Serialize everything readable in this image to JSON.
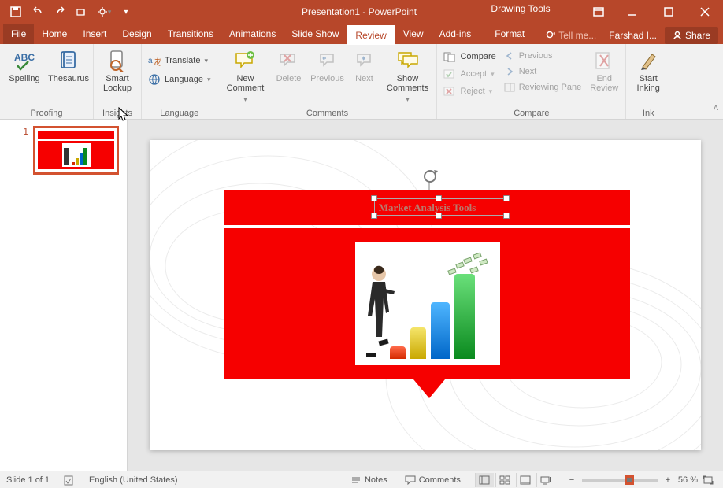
{
  "title": "Presentation1 - PowerPoint",
  "toolContext": {
    "header": "Drawing Tools",
    "tab": "Format"
  },
  "tabs": {
    "file": "File",
    "home": "Home",
    "insert": "Insert",
    "design": "Design",
    "transitions": "Transitions",
    "animations": "Animations",
    "slideshow": "Slide Show",
    "review": "Review",
    "view": "View",
    "addins": "Add-ins"
  },
  "tellme": "Tell me...",
  "account": "Farshad I...",
  "share": "Share",
  "ribbon": {
    "proofing": {
      "label": "Proofing",
      "spelling": "Spelling",
      "thesaurus": "Thesaurus"
    },
    "insights": {
      "label": "Insights",
      "smartLookup": "Smart Lookup"
    },
    "language": {
      "label": "Language",
      "translate": "Translate",
      "language": "Language"
    },
    "comments": {
      "label": "Comments",
      "new": "New Comment",
      "delete": "Delete",
      "previous": "Previous",
      "next": "Next",
      "show": "Show Comments"
    },
    "compare": {
      "label": "Compare",
      "compare": "Compare",
      "accept": "Accept",
      "reject": "Reject",
      "prev": "Previous",
      "next": "Next",
      "pane": "Reviewing Pane",
      "end": "End Review"
    },
    "ink": {
      "label": "Ink",
      "start": "Start Inking"
    }
  },
  "slide": {
    "number": "1",
    "title": "Market Analysis Tools"
  },
  "status": {
    "slideOf": "Slide 1 of 1",
    "lang": "English (United States)",
    "notes": "Notes",
    "comments": "Comments",
    "zoom": "56 %"
  },
  "chart_data": {
    "type": "bar",
    "categories": [
      "Red",
      "Yellow",
      "Blue",
      "Green"
    ],
    "values": [
      16,
      40,
      72,
      108
    ],
    "title": "",
    "xlabel": "",
    "ylabel": "",
    "ylim": [
      0,
      120
    ]
  }
}
